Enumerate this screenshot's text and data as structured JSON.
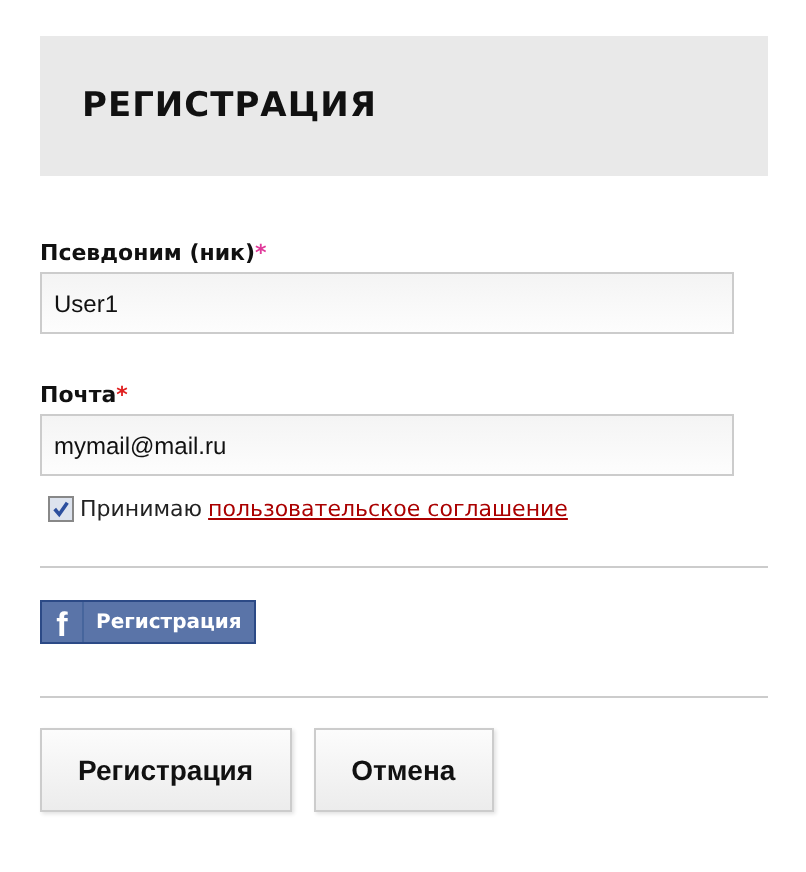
{
  "title": "РЕГИСТРАЦИЯ",
  "fields": [
    {
      "label": "Псевдоним (ник)",
      "required_mark": "*",
      "value": "User1"
    },
    {
      "label": "Почта",
      "required_mark": "*",
      "value": "mymail@mail.ru"
    }
  ],
  "agreement": {
    "checked": true,
    "text": "Принимаю",
    "link": "пользовательское соглашение"
  },
  "facebook_button": {
    "icon": "f",
    "label": "Регистрация"
  },
  "buttons": [
    "Регистрация",
    "Отмена"
  ]
}
